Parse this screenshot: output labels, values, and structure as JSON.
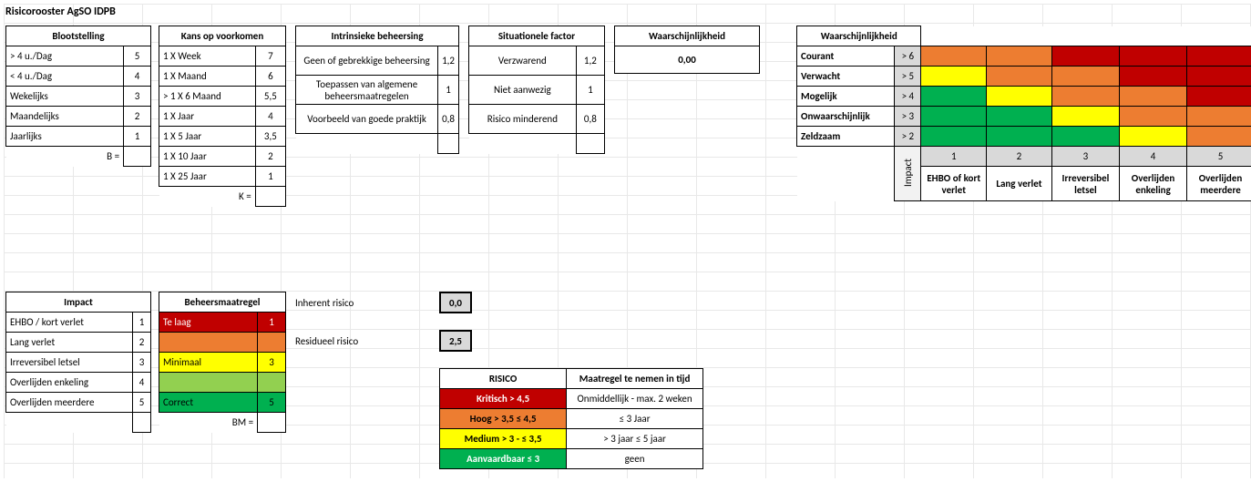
{
  "title": "Risicorooster AgSO IDPB",
  "blootstelling": {
    "header": "Blootstelling",
    "rows": [
      {
        "label": "> 4 u./Dag",
        "val": "5"
      },
      {
        "label": "< 4 u./Dag",
        "val": "4"
      },
      {
        "label": "Wekelijks",
        "val": "3"
      },
      {
        "label": "Maandelijks",
        "val": "2"
      },
      {
        "label": "Jaarlijks",
        "val": "1"
      }
    ],
    "footer": "B ="
  },
  "kans": {
    "header": "Kans op voorkomen",
    "rows": [
      {
        "label": "1 X Week",
        "val": "7"
      },
      {
        "label": "1 X Maand",
        "val": "6"
      },
      {
        "label": "> 1 X 6 Maand",
        "val": "5,5"
      },
      {
        "label": "1 X Jaar",
        "val": "4"
      },
      {
        "label": "1 X 5 Jaar",
        "val": "3,5"
      },
      {
        "label": "1 X 10 Jaar",
        "val": "2"
      },
      {
        "label": "1 X 25 Jaar",
        "val": "1"
      }
    ],
    "footer": "K ="
  },
  "intrinsiek": {
    "header": "Intrinsieke beheersing",
    "rows": [
      {
        "label": "Geen of gebrekkige beheersing",
        "val": "1,2"
      },
      {
        "label": "Toepassen van algemene beheersmaatregelen",
        "val": "1"
      },
      {
        "label": "Voorbeeld van goede praktijk",
        "val": "0,8"
      }
    ]
  },
  "situationeel": {
    "header": "Situationele factor",
    "rows": [
      {
        "label": "Verzwarend",
        "val": "1,2"
      },
      {
        "label": "Niet aanwezig",
        "val": "1"
      },
      {
        "label": "Risico minderend",
        "val": "0,8"
      }
    ]
  },
  "waarschijnlijkheid": {
    "header": "Waarschijnlijkheid",
    "value": "0,00"
  },
  "impact": {
    "header": "Impact",
    "rows": [
      {
        "label": "EHBO / kort verlet",
        "val": "1"
      },
      {
        "label": "Lang verlet",
        "val": "2"
      },
      {
        "label": "Irreversibel letsel",
        "val": "3"
      },
      {
        "label": "Overlijden enkeling",
        "val": "4"
      },
      {
        "label": "Overlijden meerdere",
        "val": "5"
      }
    ]
  },
  "beheersmaatregel": {
    "header": "Beheersmaatregel",
    "rows": [
      {
        "label": "Te laag",
        "val": "1",
        "color": "red"
      },
      {
        "label": "",
        "val": "",
        "color": "orange"
      },
      {
        "label": "Minimaal",
        "val": "3",
        "color": "yellow"
      },
      {
        "label": "",
        "val": "",
        "color": "lime"
      },
      {
        "label": "Correct",
        "val": "5",
        "color": "green"
      }
    ],
    "footer": "BM ="
  },
  "inherent": {
    "label": "Inherent risico",
    "value": "0,0"
  },
  "residueel": {
    "label": "Residueel risico",
    "value": "2,5"
  },
  "risico_legend": {
    "header_l": "RISICO",
    "header_r": "Maatregel te nemen in tijd",
    "rows": [
      {
        "l": "Kritisch > 4,5",
        "r": "Onmiddellijk - max. 2 weken",
        "color": "red"
      },
      {
        "l": "Hoog  > 3,5 ≤ 4,5",
        "r": "≤ 3 Jaar",
        "color": "orange"
      },
      {
        "l": "Medium > 3  -  ≤ 3,5",
        "r": "> 3 jaar  ≤ 5 jaar",
        "color": "yellow"
      },
      {
        "l": "Aanvaardbaar ≤  3",
        "r": "geen",
        "color": "green"
      }
    ]
  },
  "matrix": {
    "header": "Waarschijnlijkheid",
    "impact_label": "Impact",
    "rows": [
      {
        "label": "Courant",
        "thr": "> 6",
        "cells": [
          "orange",
          "orange",
          "red",
          "red",
          "red"
        ]
      },
      {
        "label": "Verwacht",
        "thr": "> 5",
        "cells": [
          "yellow",
          "orange",
          "orange",
          "red",
          "red"
        ]
      },
      {
        "label": "Mogelijk",
        "thr": "> 4",
        "cells": [
          "green",
          "yellow",
          "orange",
          "orange",
          "red"
        ]
      },
      {
        "label": "Onwaarschijnlijk",
        "thr": "> 3",
        "cells": [
          "green",
          "green",
          "yellow",
          "orange",
          "orange"
        ]
      },
      {
        "label": "Zeldzaam",
        "thr": "> 2",
        "cells": [
          "green",
          "green",
          "green",
          "yellow",
          "orange"
        ]
      }
    ],
    "col_nums": [
      "1",
      "2",
      "3",
      "4",
      "5"
    ],
    "col_labels": [
      "EHBO of kort verlet",
      "Lang verlet",
      "Irreversibel letsel",
      "Overlijden enkeling",
      "Overlijden meerdere"
    ]
  }
}
